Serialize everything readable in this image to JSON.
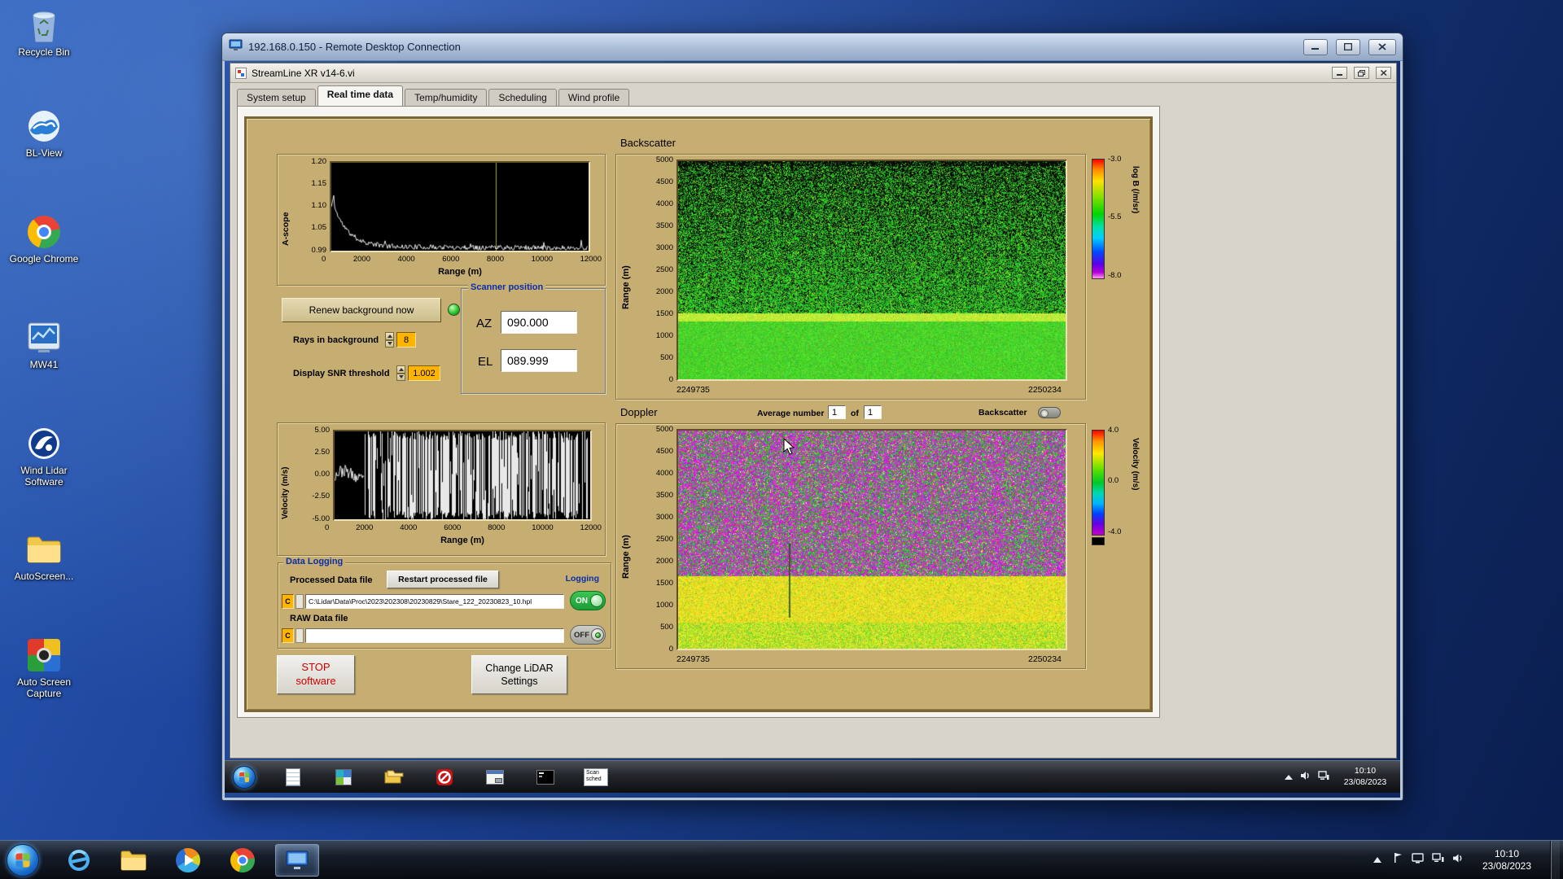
{
  "desktop": {
    "icons": [
      {
        "label": "Recycle Bin"
      },
      {
        "label": "BL-View"
      },
      {
        "label": "Google Chrome"
      },
      {
        "label": "MW41"
      },
      {
        "label": "Wind Lidar Software"
      },
      {
        "label": "AutoScreen..."
      },
      {
        "label": "Auto Screen Capture"
      }
    ]
  },
  "rdp_window": {
    "title": "192.168.0.150 - Remote Desktop Connection"
  },
  "app_window": {
    "title": "StreamLine XR v14-6.vi",
    "tabs": [
      {
        "label": "System setup"
      },
      {
        "label": "Real time data"
      },
      {
        "label": "Temp/humidity"
      },
      {
        "label": "Scheduling"
      },
      {
        "label": "Wind profile"
      }
    ]
  },
  "panel": {
    "ascope": {
      "ylabel": "A-scope",
      "xlabel": "Range (m)",
      "yticks": [
        "1.20",
        "1.15",
        "1.10",
        "1.05",
        "0.99"
      ],
      "xticks": [
        "0",
        "2000",
        "4000",
        "6000",
        "8000",
        "10000",
        "12000"
      ]
    },
    "background_controls": {
      "renew_button": "Renew background now",
      "rays_label": "Rays in background",
      "rays_value": "8",
      "snr_label": "Display SNR threshold",
      "snr_value": "1.002"
    },
    "scanner": {
      "title": "Scanner position",
      "az_label": "AZ",
      "az_value": "090.000",
      "el_label": "EL",
      "el_value": "089.999"
    },
    "backscatter": {
      "title": "Backscatter",
      "ylabel": "Range (m)",
      "yticks": [
        "5000",
        "4500",
        "4000",
        "3500",
        "3000",
        "2500",
        "2000",
        "1500",
        "1000",
        "500",
        "0"
      ],
      "x_start": "2249735",
      "x_end": "2250234",
      "colorbar": {
        "ticks": [
          "-3.0",
          "-5.5",
          "-8.0"
        ],
        "label": "log B (/m/sr)"
      }
    },
    "doppler": {
      "title": "Doppler",
      "average_label": "Average number",
      "average_value": "1",
      "of_label": "of",
      "of_count": "1",
      "display_toggle_label": "Backscatter",
      "ylabel": "Range (m)",
      "yticks": [
        "5000",
        "4500",
        "4000",
        "3500",
        "3000",
        "2500",
        "2000",
        "1500",
        "1000",
        "500",
        "0"
      ],
      "x_start": "2249735",
      "x_end": "2250234",
      "colorbar": {
        "ticks": [
          "4.0",
          "0.0",
          "-4.0"
        ],
        "label": "Velocity (m/s)"
      }
    },
    "velocity": {
      "ylabel": "Velocity (m/s)",
      "xlabel": "Range (m)",
      "yticks": [
        "5.00",
        "2.50",
        "0.00",
        "-2.50",
        "-5.00"
      ],
      "xticks": [
        "0",
        "2000",
        "4000",
        "6000",
        "8000",
        "10000",
        "12000"
      ]
    },
    "logging": {
      "title": "Data Logging",
      "processed_label": "Processed Data file",
      "restart_button": "Restart processed file",
      "logging_label": "Logging",
      "drive": "C",
      "processed_path": "C:\\Lidar\\Data\\Proc\\2023\\202308\\20230829\\Stare_122_20230823_10.hpl",
      "on_label": "ON",
      "raw_label": "RAW Data file",
      "raw_path": "",
      "off_label": "OFF"
    },
    "buttons": {
      "stop_line1": "STOP",
      "stop_line2": "software",
      "change_line1": "Change LiDAR",
      "change_line2": "Settings"
    }
  },
  "remote_taskbar": {
    "scan_label": "Scan sched",
    "clock_time": "10:10",
    "clock_date": "23/08/2023"
  },
  "host_taskbar": {
    "clock_time": "10:10",
    "clock_date": "23/08/2023"
  },
  "colors": {
    "panel_tan": "#c6ae72",
    "value_orange": "#ffb400",
    "on_green": "#2bb24a",
    "stop_red": "#cc0000",
    "led_green": "#2fc42f",
    "label_blue": "#0b2ea8"
  }
}
